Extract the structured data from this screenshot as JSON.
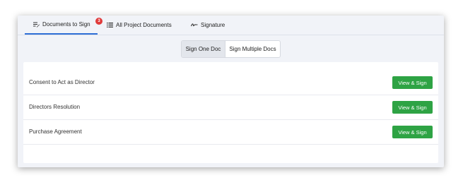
{
  "tabs": [
    {
      "label": "Documents to Sign",
      "icon": "edit-list-icon",
      "active": true,
      "badge": "3"
    },
    {
      "label": "All Project Documents",
      "icon": "list-icon",
      "active": false
    },
    {
      "label": "Signature",
      "icon": "signature-icon",
      "active": false
    }
  ],
  "segmented": {
    "options": [
      "Sign One Doc",
      "Sign Multiple Docs"
    ],
    "selected": "Sign One Doc"
  },
  "documents": [
    {
      "name": "Consent to Act as Director",
      "action": "View & Sign"
    },
    {
      "name": "Directors Resolution",
      "action": "View & Sign"
    },
    {
      "name": "Purchase Agreement",
      "action": "View & Sign"
    }
  ],
  "colors": {
    "accent": "#2f6fd6",
    "button": "#2ea344",
    "badge": "#e03a3a"
  }
}
